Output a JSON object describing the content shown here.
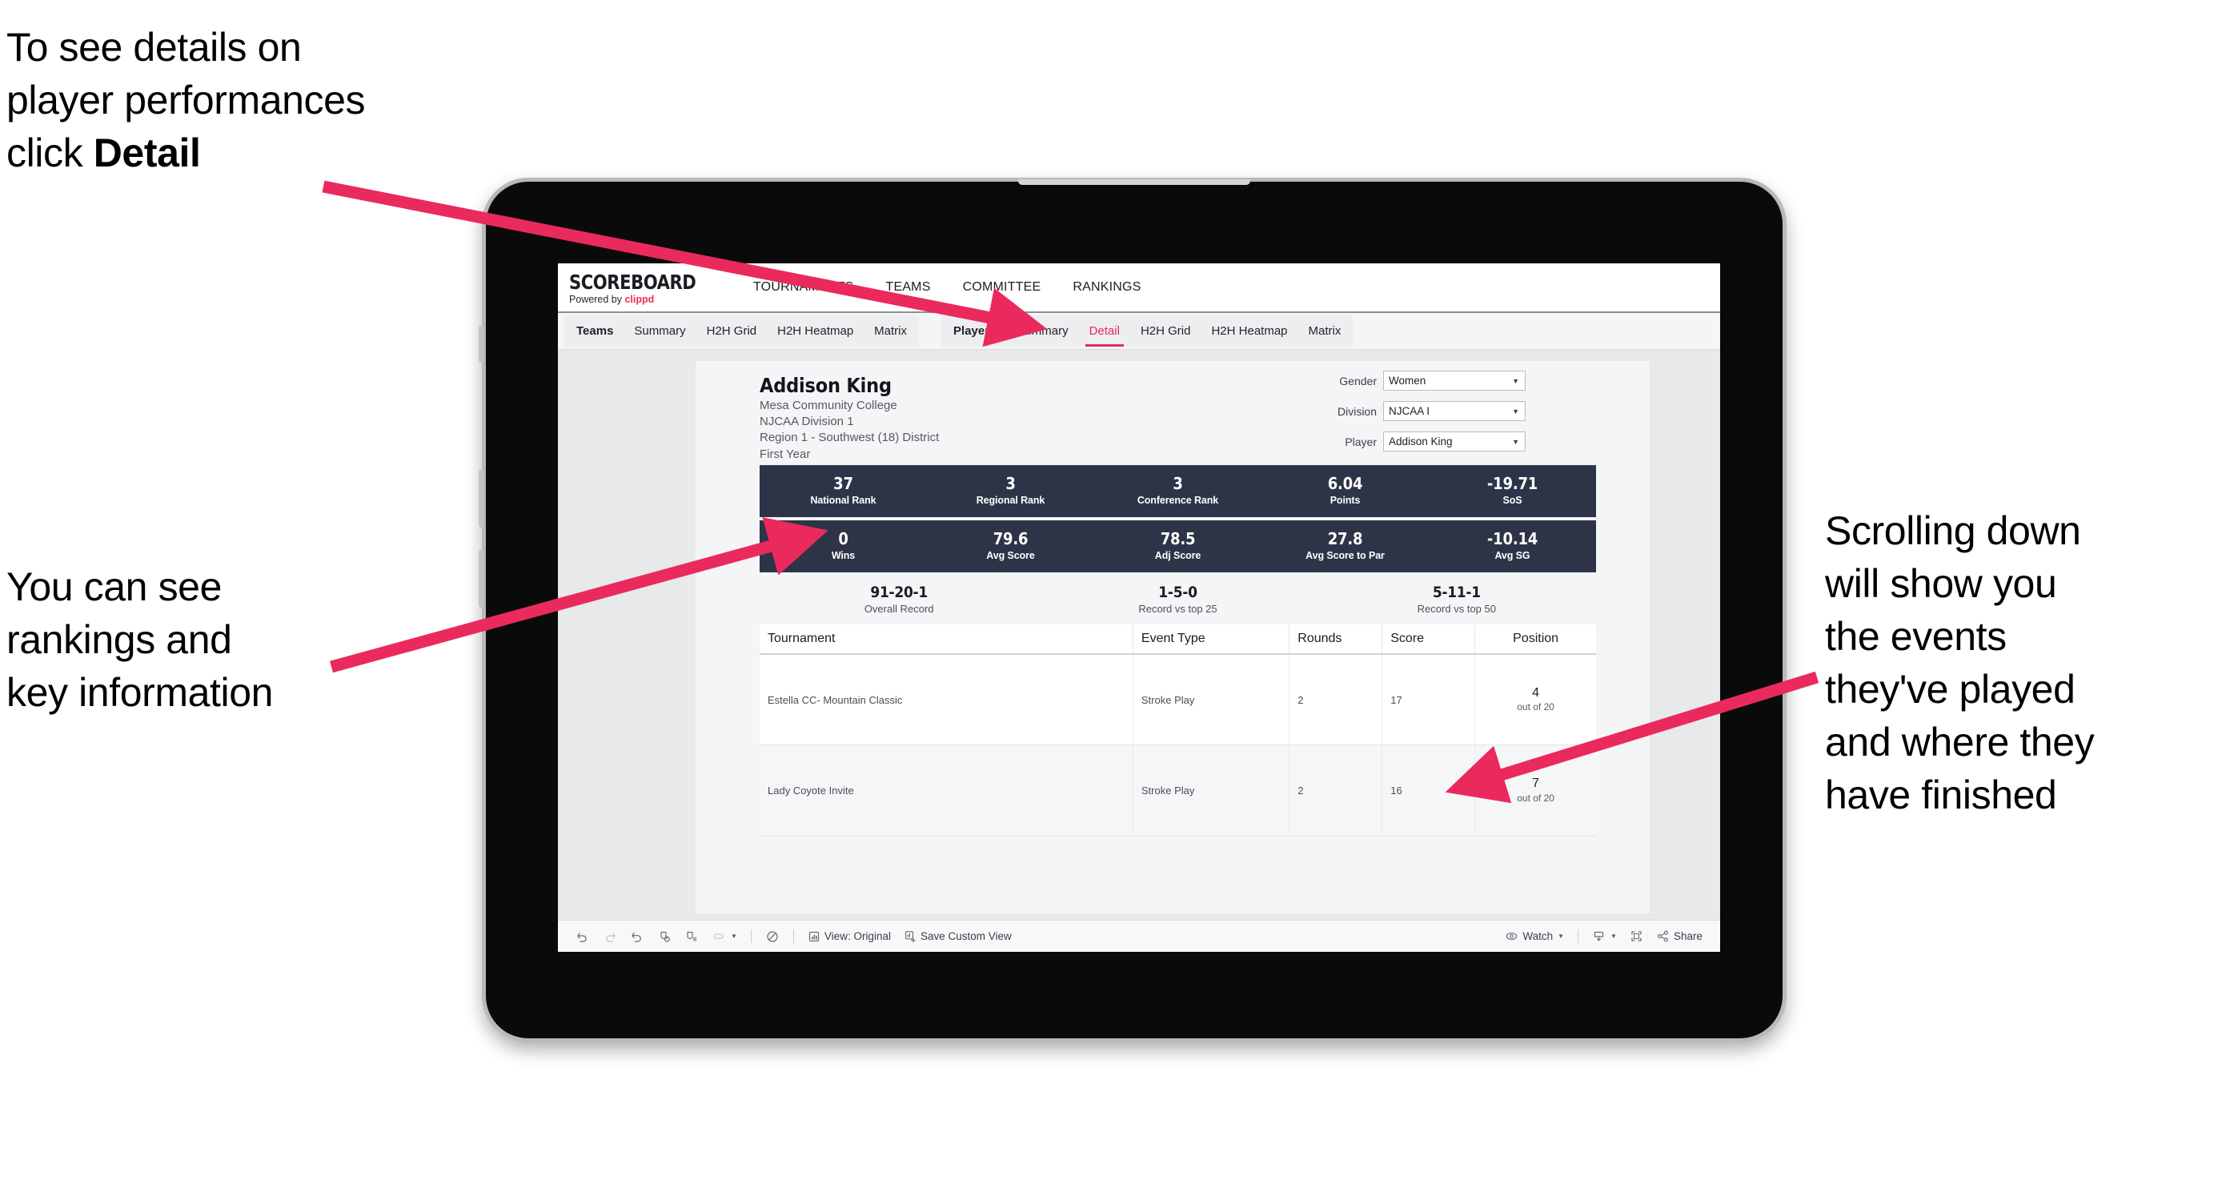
{
  "annotations": {
    "top_left": "To see details on\nplayer performances\nclick ",
    "top_left_bold": "Detail",
    "mid_left": "You can see\nrankings and\nkey information",
    "right": "Scrolling down\nwill show you\nthe events\nthey've played\nand where they\nhave finished",
    "arrow_color": "#ea2a5d"
  },
  "app": {
    "brand_title": "SCOREBOARD",
    "brand_sub_prefix": "Powered by ",
    "brand_sub_name": "clippd",
    "nav": [
      {
        "label": "TOURNAMENTS"
      },
      {
        "label": "TEAMS"
      },
      {
        "label": "COMMITTEE"
      },
      {
        "label": "RANKINGS"
      }
    ],
    "tab_group_teams": [
      {
        "label": "Teams",
        "lead": true,
        "active": false
      },
      {
        "label": "Summary",
        "lead": false,
        "active": false
      },
      {
        "label": "H2H Grid",
        "lead": false,
        "active": false
      },
      {
        "label": "H2H Heatmap",
        "lead": false,
        "active": false
      },
      {
        "label": "Matrix",
        "lead": false,
        "active": false
      }
    ],
    "tab_group_players": [
      {
        "label": "Players",
        "lead": true,
        "active": false
      },
      {
        "label": "Summary",
        "lead": false,
        "active": false
      },
      {
        "label": "Detail",
        "lead": false,
        "active": true
      },
      {
        "label": "H2H Grid",
        "lead": false,
        "active": false
      },
      {
        "label": "H2H Heatmap",
        "lead": false,
        "active": false
      },
      {
        "label": "Matrix",
        "lead": false,
        "active": false
      }
    ]
  },
  "player": {
    "name": "Addison King",
    "school": "Mesa Community College",
    "division": "NJCAA Division 1",
    "region": "Region 1 - Southwest (18) District",
    "year": "First Year"
  },
  "filters": [
    {
      "label": "Gender",
      "value": "Women"
    },
    {
      "label": "Division",
      "value": "NJCAA I"
    },
    {
      "label": "Player",
      "value": "Addison King"
    }
  ],
  "kpis_row1": [
    {
      "value": "37",
      "label": "National Rank"
    },
    {
      "value": "3",
      "label": "Regional Rank"
    },
    {
      "value": "3",
      "label": "Conference Rank"
    },
    {
      "value": "6.04",
      "label": "Points"
    },
    {
      "value": "-19.71",
      "label": "SoS"
    }
  ],
  "kpis_row2": [
    {
      "value": "0",
      "label": "Wins"
    },
    {
      "value": "79.6",
      "label": "Avg Score"
    },
    {
      "value": "78.5",
      "label": "Adj Score"
    },
    {
      "value": "27.8",
      "label": "Avg Score to Par"
    },
    {
      "value": "-10.14",
      "label": "Avg SG"
    }
  ],
  "records": [
    {
      "value": "91-20-1",
      "label": "Overall Record"
    },
    {
      "value": "1-5-0",
      "label": "Record vs top 25"
    },
    {
      "value": "5-11-1",
      "label": "Record vs top 50"
    }
  ],
  "table": {
    "headers": [
      "Tournament",
      "Event Type",
      "Rounds",
      "Score",
      "Position"
    ],
    "rows": [
      {
        "tournament": "Estella CC- Mountain Classic",
        "event_type": "Stroke Play",
        "rounds": "2",
        "score": "17",
        "position": "4",
        "position_sub": "out of 20"
      },
      {
        "tournament": "Lady Coyote Invite",
        "event_type": "Stroke Play",
        "rounds": "2",
        "score": "16",
        "position": "7",
        "position_sub": "out of 20"
      }
    ]
  },
  "toolbar": {
    "view_label": "View: Original",
    "save_label": "Save Custom View",
    "watch_label": "Watch",
    "share_label": "Share"
  },
  "colors": {
    "accent_pink": "#e8285c",
    "kpi_navy": "#2e3448",
    "screen_bg": "#e7e9eb"
  }
}
